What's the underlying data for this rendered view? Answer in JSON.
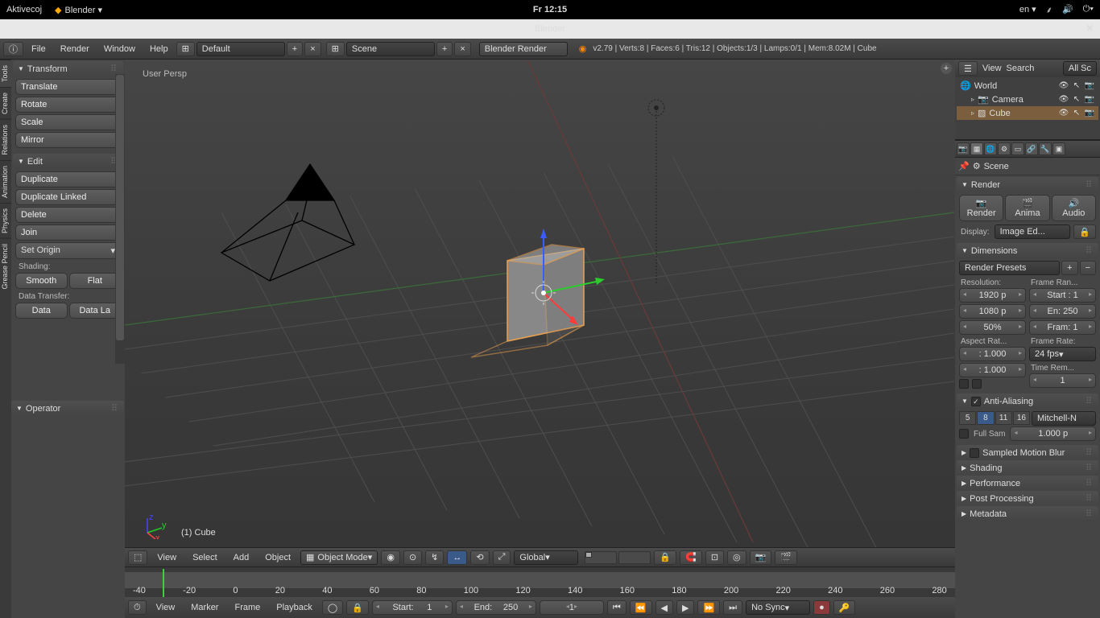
{
  "os": {
    "left": "Aktivecoj",
    "app": "Blender ▾",
    "clock": "Fr 12:15",
    "lang": "en ▾"
  },
  "window": {
    "title": "Blender"
  },
  "menu": {
    "items": [
      "File",
      "Render",
      "Window",
      "Help"
    ],
    "layout": "Default",
    "scene_label": "Scene",
    "engine": "Blender Render"
  },
  "stats": "v2.79 | Verts:8 | Faces:6 | Tris:12 | Objects:1/3 | Lamps:0/1 | Mem:8.02M | Cube",
  "tool_tabs": [
    "Tools",
    "Create",
    "Relations",
    "Animation",
    "Physics",
    "Grease Pencil"
  ],
  "transform": {
    "title": "Transform",
    "btns": [
      "Translate",
      "Rotate",
      "Scale",
      "Mirror"
    ]
  },
  "edit": {
    "title": "Edit",
    "btns": [
      "Duplicate",
      "Duplicate Linked",
      "Delete",
      "Join"
    ],
    "set_origin": "Set Origin",
    "shading_label": "Shading:",
    "shading": [
      "Smooth",
      "Flat"
    ],
    "data_transfer_label": "Data Transfer:",
    "data": [
      "Data",
      "Data La"
    ]
  },
  "operator": "Operator",
  "viewport": {
    "persp": "User Persp",
    "obj": "(1) Cube",
    "header_menus": [
      "View",
      "Select",
      "Add",
      "Object"
    ],
    "mode": "Object Mode",
    "orientation": "Global"
  },
  "outliner": {
    "head": [
      "View",
      "Search",
      "All Sc"
    ],
    "items": [
      {
        "icon": "🌐",
        "name": "World"
      },
      {
        "icon": "📷",
        "name": "Camera",
        "indent": 1
      },
      {
        "icon": "▨",
        "name": "Cube",
        "indent": 1,
        "active": true
      }
    ]
  },
  "context": "Scene",
  "render": {
    "title": "Render",
    "render": "Render",
    "anima": "Anima",
    "audio": "Audio",
    "display_label": "Display:",
    "display": "Image Ed..."
  },
  "dimensions": {
    "title": "Dimensions",
    "presets": "Render Presets",
    "res_label": "Resolution:",
    "frame_label": "Frame Ran...",
    "res_x": "1920 p",
    "res_y": "1080 p",
    "res_pct": "50%",
    "start": "Start : 1",
    "end": "En: 250",
    "step": "Fram: 1",
    "aspect_label": "Aspect Rat...",
    "rate_label": "Frame Rate:",
    "ax": ": 1.000",
    "ay": ": 1.000",
    "fps": "24 fps",
    "time_rem": "Time Rem...",
    "one": "1"
  },
  "aa": {
    "title": "Anti-Aliasing",
    "samples": [
      "5",
      "8",
      "11",
      "16"
    ],
    "active": "8",
    "filter": "Mitchell-N",
    "full": "Full Sam",
    "size": "1.000 p"
  },
  "collapsed_panels": [
    "Sampled Motion Blur",
    "Shading",
    "Performance",
    "Post Processing",
    "Metadata"
  ],
  "timeline": {
    "menus": [
      "View",
      "Marker",
      "Frame",
      "Playback"
    ],
    "start_label": "Start:",
    "start": "1",
    "end_label": "End:",
    "end": "250",
    "cur": "1",
    "sync": "No Sync",
    "ticks": [
      "-40",
      "-20",
      "0",
      "20",
      "40",
      "60",
      "80",
      "100",
      "120",
      "140",
      "160",
      "180",
      "200",
      "220",
      "240",
      "260",
      "280"
    ]
  }
}
